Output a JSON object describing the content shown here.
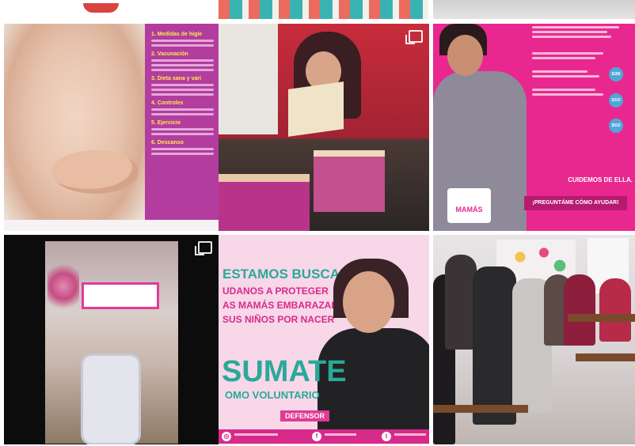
{
  "grid": {
    "tiles": [
      {
        "id": "tile-pregnancy-tips",
        "heading_lines": [
          "1. Medidas de higie",
          "2. Vacunación",
          "3. Dieta sana y vari",
          "4. Controles",
          "5. Ejercicio",
          "6. Descanso"
        ]
      },
      {
        "id": "tile-crafting-boxes",
        "multi_image": true
      },
      {
        "id": "tile-monthly-commitment",
        "closing_text": "CUIDEMOS DE ELLA.",
        "cta_text": "¡PREGUNTÁME CÓMO AYUDAR!",
        "logo_text": "MAMÁS",
        "badges": [
          "$180",
          "$310",
          "$510"
        ]
      },
      {
        "id": "tile-candy-jar",
        "multi_image": true
      },
      {
        "id": "tile-volunteer-campaign",
        "line1": "ESTAMOS BUSCANDO",
        "line2": "UDANOS A PROTEGER",
        "line3": "AS MAMÁS EMBARAZADAS",
        "line4": "SUS NIÑOS POR NACER",
        "headline": "SUMATE",
        "subline": "OMO VOLUNTARIO",
        "ribbon": "DEFENSOR"
      },
      {
        "id": "tile-community-meeting"
      }
    ]
  },
  "colors": {
    "magenta": "#e9288f",
    "teal": "#2aa99a",
    "purple_panel": "#b23d9e"
  }
}
